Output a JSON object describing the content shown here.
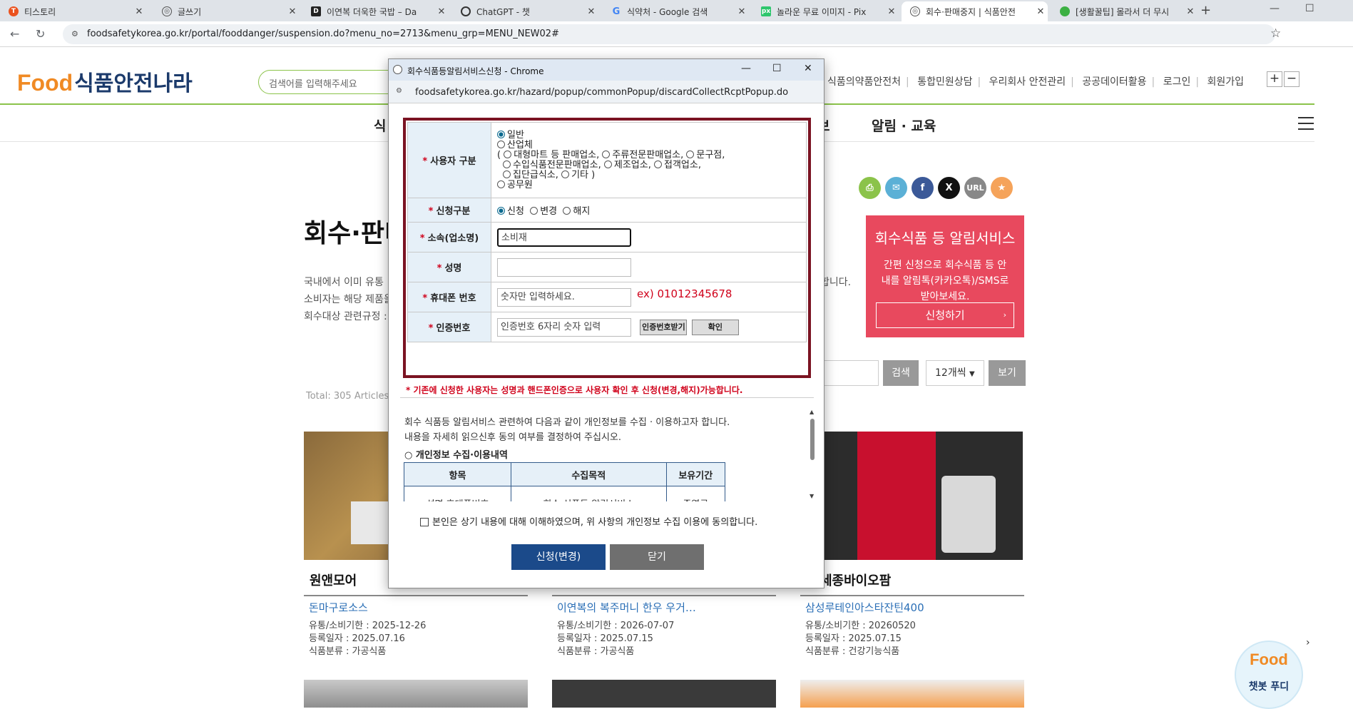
{
  "browser": {
    "tabs": [
      {
        "title": "티스토리",
        "icon": "tistory-icon",
        "color": "#eb531f",
        "glyph": "T"
      },
      {
        "title": "글쓰기",
        "icon": "globe-icon",
        "color": "#555555",
        "glyph": ""
      },
      {
        "title": "이연복 더욱한 국밥 – Da",
        "icon": "d-logo-icon",
        "color": "#222222",
        "glyph": "D"
      },
      {
        "title": "ChatGPT - 챗",
        "icon": "chatgpt-icon",
        "color": "#333333",
        "glyph": ""
      },
      {
        "title": "식약처 - Google 검색",
        "icon": "google-icon",
        "color": "#4285f4",
        "glyph": "G"
      },
      {
        "title": "놀라운 무료 이미지 - Pix",
        "icon": "pixabay-icon",
        "color": "#2ec66d",
        "glyph": "px"
      },
      {
        "title": "회수·판매중지 | 식품안전",
        "icon": "globe-icon",
        "color": "#555555",
        "glyph": ""
      },
      {
        "title": "[생활꿀팁] 몰라서 더 무시",
        "icon": "leaf-icon",
        "color": "#3cb043",
        "glyph": ""
      }
    ],
    "url": "foodsafetykorea.go.kr/portal/fooddanger/suspension.do?menu_no=2713&menu_grp=MENU_NEW02#"
  },
  "site": {
    "logo_food": "Food",
    "logo_name": "식품안전나라",
    "search_placeholder": "검색어를 입력해주세요",
    "top_links": [
      "식품의약품안전처",
      "통합민원상담",
      "우리회사 안전관리",
      "공공데이터활용",
      "로그인",
      "회원가입"
    ],
    "zoom_in": "+",
    "zoom_out": "−",
    "gnb_partial": "식",
    "gnb_info": "보",
    "gnb_alert": "알림 · 교육"
  },
  "main": {
    "title": "회수·판미",
    "desc_lines": [
      "국내에서 이미 유통",
      "소비자는 해당 제품을",
      "회수대상 관련규정 :"
    ],
    "desc_end": "합니다.",
    "share": [
      "print",
      "mail",
      "f",
      "X",
      "URL",
      "★"
    ],
    "promo_title": "회수식품 등 알림서비스",
    "promo_desc": "간편 신청으로 회수식품 등 안내를 알림톡(카카오톡)/SMS로 받아보세요.",
    "promo_btn": "신청하기",
    "search_btn": "검색",
    "per_page": "12개씩",
    "view_btn": "보기",
    "total": "Total: 305 Articles",
    "products": [
      {
        "name": "원앤모어",
        "link": "돈마구로소스",
        "expiry": "유통/소비기한 : 2025-12-26",
        "reg": "등록일자 : 2025.07.16",
        "category": "식품분류 : 가공식품"
      },
      {
        "name": "",
        "link": "이연복의 복주머니 한우 우거…",
        "expiry": "유통/소비기한 : 2026-07-07",
        "reg": "등록일자 : 2025.07.15",
        "category": "식품분류 : 가공식품"
      },
      {
        "name": "세종바이오팜",
        "link": "삼성루테인아스타잔틴400",
        "expiry": "유통/소비기한 : 20260520",
        "reg": "등록일자 : 2025.07.15",
        "category": "식품분류 : 건강기능식품"
      }
    ],
    "chatbot_logo": "Food",
    "chatbot_name": "챗봇 푸디"
  },
  "popup": {
    "window_title": "회수식품등알림서비스신청 - Chrome",
    "url": "foodsafetykorea.go.kr/hazard/popup/commonPopup/discardCollectRcptPopup.do",
    "labels": {
      "user_type": "사용자 구분",
      "apply_type": "신청구분",
      "org": "소속(업소명)",
      "name": "성명",
      "phone": "휴대폰 번호",
      "auth": "인증번호"
    },
    "user_type_options": {
      "general": "일반",
      "industry": "산업체",
      "open_paren": "(",
      "sub1": "대형마트 등 판매업소,",
      "sub2": "주류전문판매업소,",
      "sub3": "문구점,",
      "sub4": "수입식품전문판매업소,",
      "sub5": "제조업소,",
      "sub6": "접객업소,",
      "sub7": "집단급식소,",
      "sub8": "기타 )",
      "public": "공무원"
    },
    "apply_options": [
      "신청",
      "변경",
      "해지"
    ],
    "org_value": "소비재",
    "name_value": "",
    "phone_placeholder": "숫자만 입력하세요.",
    "phone_example": "ex) 01012345678",
    "auth_placeholder": "인증번호 6자리 숫자 입력",
    "auth_request_btn": "인증번호받기",
    "auth_confirm_btn": "확인",
    "notice": "* 기존에 신청한 사용자는 성명과 핸드폰인증으로 사용자 확인 후 신청(변경,해지)가능합니다.",
    "consent_line1": "회수 식품등 알림서비스 관련하여 다음과 같이 개인정보를 수집 · 이용하고자 합니다.",
    "consent_line2": "내용을 자세히 읽으신후 동의 여부를 결정하여 주십시오.",
    "consent_head": "○ 개인정보 수집·이용내역",
    "privacy_headers": [
      "항목",
      "수집목적",
      "보유기간"
    ],
    "privacy_row": [
      "성명,휴대폰번호",
      "회수 식품등 알림서비스",
      "준영구"
    ],
    "agree_text": "본인은 상기 내용에 대해 이해하였으며, 위 사항의 개인정보 수집 이용에 동의합니다.",
    "submit_btn": "신청(변경)",
    "close_btn": "닫기"
  }
}
